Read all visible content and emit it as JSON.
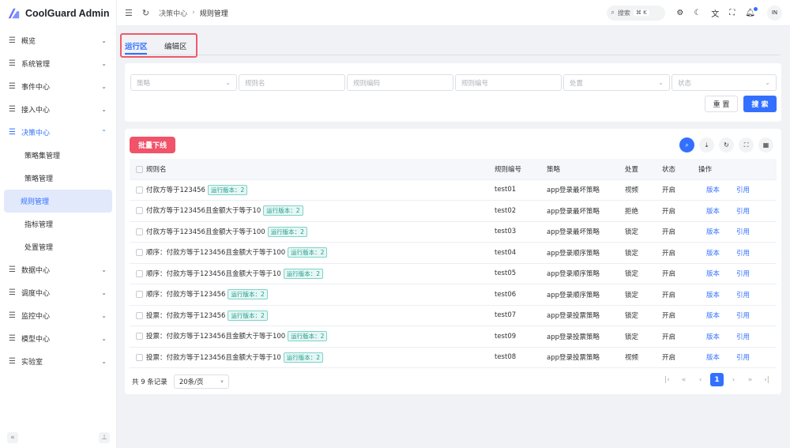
{
  "app": {
    "title": "CoolGuard Admin"
  },
  "header": {
    "breadcrumb": [
      "决策中心",
      "规则管理"
    ],
    "search_label": "搜索",
    "search_shortcut": "⌘ K",
    "avatar_text": "IN"
  },
  "sidebar": {
    "items": [
      {
        "label": "概览",
        "open": false
      },
      {
        "label": "系统管理",
        "open": false
      },
      {
        "label": "事件中心",
        "open": false
      },
      {
        "label": "接入中心",
        "open": false
      },
      {
        "label": "决策中心",
        "open": true
      },
      {
        "label": "数据中心",
        "open": false
      },
      {
        "label": "调度中心",
        "open": false
      },
      {
        "label": "监控中心",
        "open": false
      },
      {
        "label": "模型中心",
        "open": false
      },
      {
        "label": "实验室",
        "open": false
      }
    ],
    "sub_items": [
      "策略集管理",
      "策略管理",
      "规则管理",
      "指标管理",
      "处置管理"
    ],
    "active_sub": "规则管理"
  },
  "tabs": [
    {
      "label": "运行区",
      "active": true
    },
    {
      "label": "编辑区",
      "active": false
    }
  ],
  "filters": {
    "strategy_placeholder": "策略",
    "rule_name_placeholder": "规则名",
    "rule_code_placeholder": "规则编码",
    "rule_no_placeholder": "规则编号",
    "action_placeholder": "处置",
    "status_placeholder": "状态",
    "reset_label": "重 置",
    "search_label": "搜 索"
  },
  "table": {
    "batch_offline_label": "批量下线",
    "columns": [
      "规则名",
      "规则编号",
      "策略",
      "处置",
      "状态",
      "操作"
    ],
    "rows": [
      {
        "name": "付款方等于123456",
        "tag": "运行版本：2",
        "code": "test01",
        "strategy": "app登录最坏策略",
        "action": "视频",
        "status": "开启"
      },
      {
        "name": "付款方等于123456且金额大于等于10",
        "tag": "运行版本：2",
        "code": "test02",
        "strategy": "app登录最坏策略",
        "action": "拒绝",
        "status": "开启"
      },
      {
        "name": "付款方等于123456且金额大于等于100",
        "tag": "运行版本：2",
        "code": "test03",
        "strategy": "app登录最坏策略",
        "action": "锁定",
        "status": "开启"
      },
      {
        "name": "顺序：付款方等于123456且金额大于等于100",
        "tag": "运行版本：2",
        "code": "test04",
        "strategy": "app登录顺序策略",
        "action": "锁定",
        "status": "开启"
      },
      {
        "name": "顺序：付款方等于123456且金额大于等于10",
        "tag": "运行版本：2",
        "code": "test05",
        "strategy": "app登录顺序策略",
        "action": "锁定",
        "status": "开启"
      },
      {
        "name": "顺序：付款方等于123456",
        "tag": "运行版本：2",
        "code": "test06",
        "strategy": "app登录顺序策略",
        "action": "锁定",
        "status": "开启"
      },
      {
        "name": "投票：付款方等于123456",
        "tag": "运行版本：2",
        "code": "test07",
        "strategy": "app登录投票策略",
        "action": "锁定",
        "status": "开启"
      },
      {
        "name": "投票：付款方等于123456且金额大于等于100",
        "tag": "运行版本：2",
        "code": "test09",
        "strategy": "app登录投票策略",
        "action": "锁定",
        "status": "开启"
      },
      {
        "name": "投票：付款方等于123456且金额大于等于10",
        "tag": "运行版本：2",
        "code": "test08",
        "strategy": "app登录投票策略",
        "action": "视频",
        "status": "开启"
      }
    ],
    "op_version": "版本",
    "op_reference": "引用"
  },
  "pagination": {
    "total_text": "共 9 条记录",
    "page_size": "20条/页",
    "current_page": "1"
  },
  "colors": {
    "primary": "#3370ff",
    "danger": "#f0536a",
    "highlight_border": "#f05a6b"
  }
}
